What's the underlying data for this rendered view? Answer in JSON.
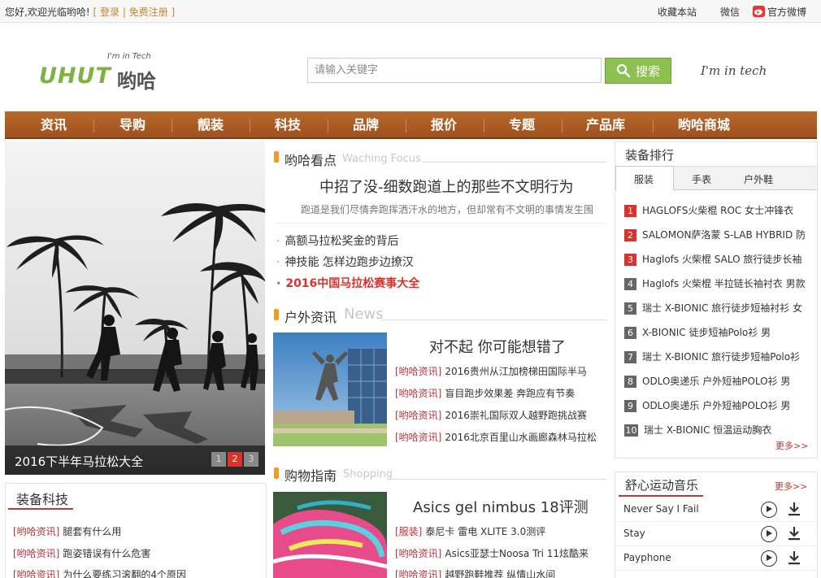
{
  "topbar": {
    "welcome": "您好,欢迎光临哟哈!",
    "login": "登录",
    "register": "免费注册",
    "bookmark": "收藏本站",
    "wechat": "微信",
    "weibo": "官方微博"
  },
  "header": {
    "logo_tag": "I'm in Tech",
    "logo_main": "UHUT",
    "logo_cn": "哟哈",
    "search_placeholder": "请输入关键字",
    "search_button": "搜索",
    "slogan": "I'm in tech"
  },
  "nav": [
    "资讯",
    "导购",
    "靓装",
    "科技",
    "品牌",
    "报价",
    "专题",
    "产品库",
    "哟哈商城"
  ],
  "hero": {
    "caption": "2016下半年马拉松大全",
    "pages": [
      "1",
      "2",
      "3"
    ],
    "active_page": "2"
  },
  "focus": {
    "title": "哟哈看点",
    "title_en": "Waching Focus",
    "headline": "中招了没-细数跑道上的那些不文明行为",
    "summary": "跑道是我们尽情奔跑挥洒汗水的地方，但却常有不文明的事情发生围",
    "links": [
      "高额马拉松奖金的背后",
      "神技能 怎样边跑步边撩汉",
      "2016中国马拉松赛事大全"
    ]
  },
  "news": {
    "title": "户外资讯",
    "title_en": "News",
    "headline": "对不起 你可能想错了",
    "items": [
      {
        "tag": "[哟哈资讯]",
        "text": "2016贵州从江加榜梯田国际半马"
      },
      {
        "tag": "[哟哈资讯]",
        "text": "盲目跑步效果差 奔跑应有节奏"
      },
      {
        "tag": "[哟哈资讯]",
        "text": "2016崇礼国际双人越野跑挑战赛"
      },
      {
        "tag": "[哟哈资讯]",
        "text": "2016北京百里山水画廊森林马拉松"
      }
    ]
  },
  "shopping": {
    "title": "购物指南",
    "title_en": "Shopping",
    "headline": "Asics gel nimbus 18评测",
    "items": [
      {
        "tag": "[服装]",
        "text": "泰尼卡 雷电 XLITE 3.0测评"
      },
      {
        "tag": "[哟哈资讯]",
        "text": "Asics亚瑟士Noosa Tri 11炫酷来"
      },
      {
        "tag": "[哟哈资讯]",
        "text": "越野跑鞋推荐 纵情山水间"
      }
    ]
  },
  "gear_tech": {
    "title": "装备科技",
    "items": [
      {
        "tag": "[哟哈资讯]",
        "text": "腿套有什么用"
      },
      {
        "tag": "[哟哈资讯]",
        "text": "跑姿错误有什么危害"
      },
      {
        "tag": "[哟哈资讯]",
        "text": "为什么要练习滚翻的4个原因"
      }
    ]
  },
  "ranking": {
    "title": "装备排行",
    "tabs": [
      "服装",
      "手表",
      "户外鞋"
    ],
    "active_tab": "服装",
    "items": [
      "HAGLOFS火柴棍 ROC 女士冲锋衣",
      "SALOMON萨洛蒙 S-LAB HYBRID 防",
      "Haglofs 火柴棍 SALO 旅行徒步长袖",
      "Haglofs 火柴棍 半拉链长袖衬衣 男款",
      "瑞士 X-BIONIC 旅行徒步短袖衬衫 女",
      "X-BIONIC 徒步短袖Polo衫 男",
      "瑞士 X-BIONIC 旅行徒步短袖Polo衫",
      "ODLO奥递乐 户外短袖POLO衫 男",
      "ODLO奥递乐 户外短袖POLO衫 男",
      "瑞士 X-BIONIC 恒温运动胸衣"
    ],
    "more": "更多>>"
  },
  "music": {
    "title": "舒心运动音乐",
    "more": "更多>>",
    "songs": [
      "Never Say I Fail",
      "Stay",
      "Payphone"
    ]
  },
  "colors": {
    "nav": "#a95a24",
    "accent_orange": "#f29b1c",
    "search_green": "#8cc152",
    "tag_red": "#b8323b"
  }
}
